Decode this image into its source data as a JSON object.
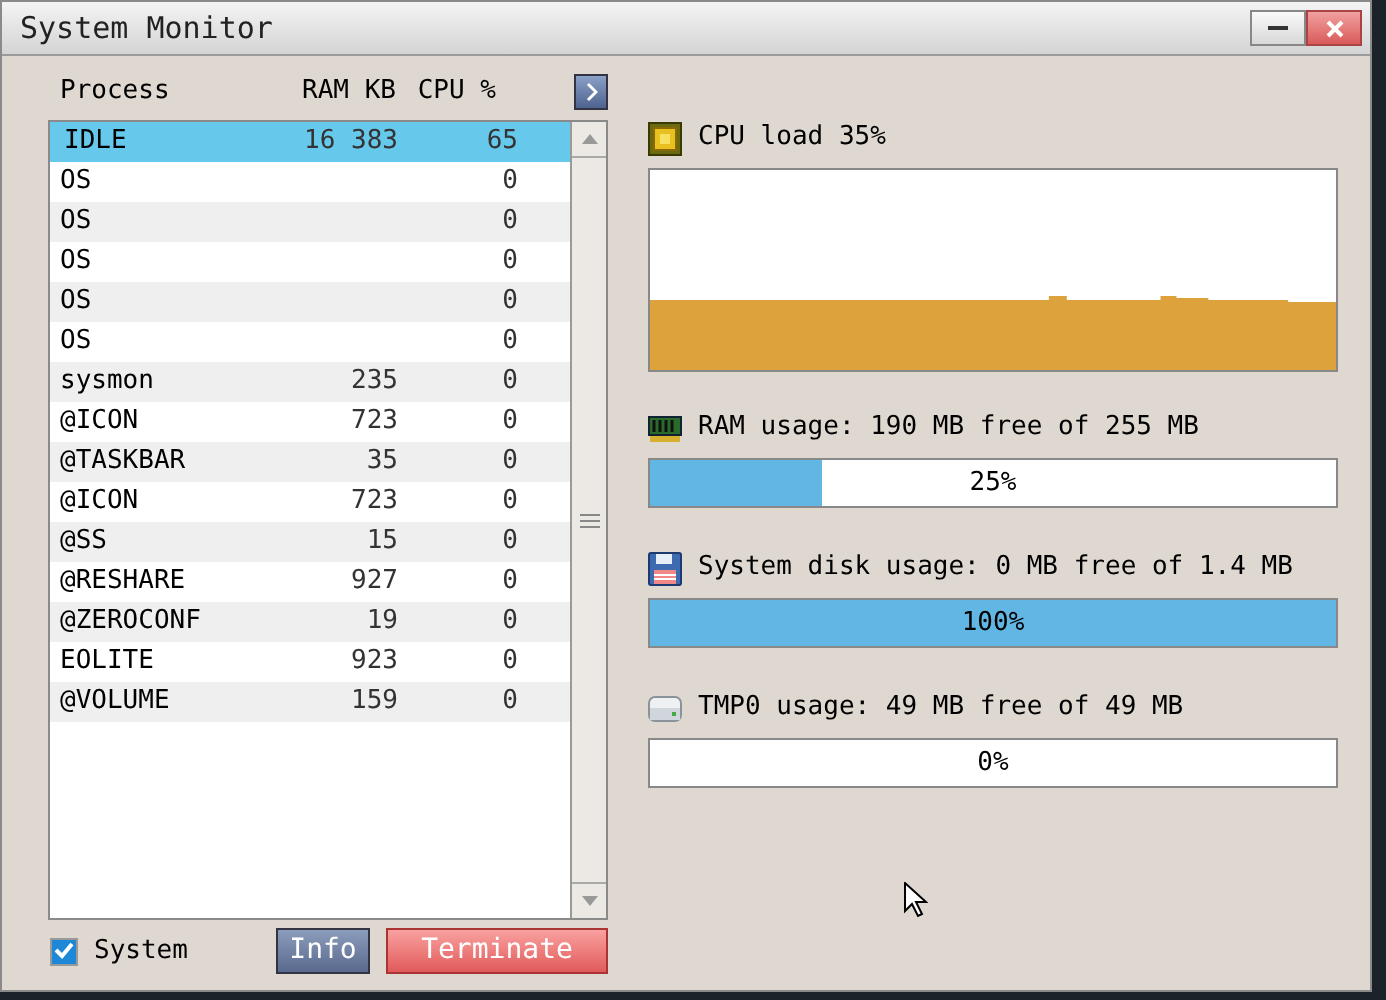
{
  "window": {
    "title": "System Monitor"
  },
  "table": {
    "columns": [
      "Process",
      "RAM KB",
      "CPU %"
    ],
    "rows": [
      {
        "process": "IDLE",
        "ram": "16 383",
        "cpu": "65",
        "selected": true
      },
      {
        "process": "OS",
        "ram": "",
        "cpu": "0",
        "selected": false
      },
      {
        "process": "OS",
        "ram": "",
        "cpu": "0",
        "selected": false
      },
      {
        "process": "OS",
        "ram": "",
        "cpu": "0",
        "selected": false
      },
      {
        "process": "OS",
        "ram": "",
        "cpu": "0",
        "selected": false
      },
      {
        "process": "OS",
        "ram": "",
        "cpu": "0",
        "selected": false
      },
      {
        "process": "sysmon",
        "ram": "235",
        "cpu": "0",
        "selected": false
      },
      {
        "process": "@ICON",
        "ram": "723",
        "cpu": "0",
        "selected": false
      },
      {
        "process": "@TASKBAR",
        "ram": "35",
        "cpu": "0",
        "selected": false
      },
      {
        "process": "@ICON",
        "ram": "723",
        "cpu": "0",
        "selected": false
      },
      {
        "process": "@SS",
        "ram": "15",
        "cpu": "0",
        "selected": false
      },
      {
        "process": "@RESHARE",
        "ram": "927",
        "cpu": "0",
        "selected": false
      },
      {
        "process": "@ZEROCONF",
        "ram": "19",
        "cpu": "0",
        "selected": false
      },
      {
        "process": "EOLITE",
        "ram": "923",
        "cpu": "0",
        "selected": false
      },
      {
        "process": "@VOLUME",
        "ram": "159",
        "cpu": "0",
        "selected": false
      }
    ]
  },
  "system_checkbox": {
    "label": "System",
    "checked": true
  },
  "buttons": [
    {
      "label": "Info",
      "kind": "info"
    },
    {
      "label": "Terminate",
      "kind": "danger"
    }
  ],
  "cpu": {
    "label": "CPU load 35%"
  },
  "meters": [
    {
      "kind": "ram",
      "label": "RAM usage: 190 MB free of 255 MB",
      "level": 0.25,
      "reading": "25%"
    },
    {
      "kind": "disk",
      "label": "System disk usage: 0 MB free of 1.4 MB",
      "level": 1,
      "reading": "100%"
    },
    {
      "kind": "drive",
      "label": "TMP0 usage: 49 MB free of 49 MB",
      "level": 0,
      "reading": "0%"
    }
  ]
}
